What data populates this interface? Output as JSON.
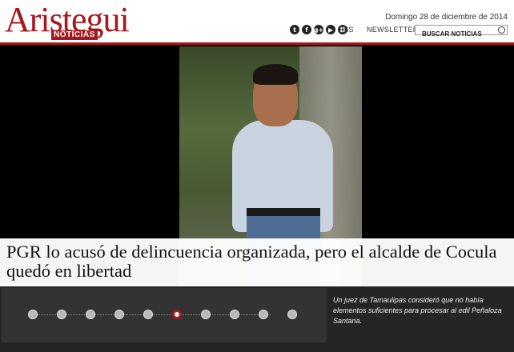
{
  "header": {
    "logo": "Aristegui",
    "logo_sub": "NOTICIAS",
    "date": "Domingo 28 de diciembre de 2014",
    "social": [
      {
        "icon": "twitter-icon",
        "glyph": "t"
      },
      {
        "icon": "facebook-icon",
        "glyph": "f"
      },
      {
        "icon": "googleplus-icon",
        "glyph": "g+"
      },
      {
        "icon": "youtube-icon",
        "glyph": "▶"
      },
      {
        "icon": "instagram-icon",
        "glyph": "◘"
      }
    ],
    "rss": "RSS",
    "newsletter": "NEWSLETTER",
    "search_placeholder": "BUSCAR NOTICIAS"
  },
  "slide": {
    "headline": "PGR lo acusó de delincuencia organizada, pero el alcalde de Cocula quedó en libertad",
    "caption": "Un juez de Tamaulipas consideró que no había elementos suficientes para procesar al edil Peñaloza Santana."
  },
  "slider": {
    "count": 10,
    "active_index": 5
  },
  "colors": {
    "brand_red": "#a8171c",
    "panel": "#333333",
    "background": "#000000"
  }
}
